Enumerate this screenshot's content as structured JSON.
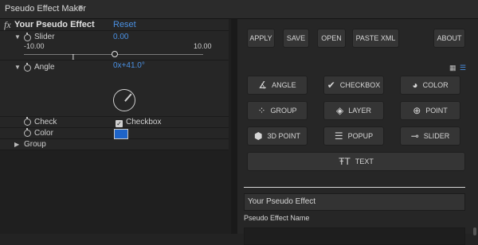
{
  "window": {
    "tab_title": "Pseudo Effect Maker",
    "menu_icon": "hamburger-menu-icon"
  },
  "effect": {
    "fx_label": "fx",
    "name": "Your Pseudo Effect",
    "reset_label": "Reset",
    "params": {
      "slider": {
        "label": "Slider",
        "value": "0.00",
        "min": "-10.00",
        "max": "10.00",
        "position_fraction": 0.5
      },
      "angle": {
        "label": "Angle",
        "value": "0x+41.0°",
        "degrees": 41
      },
      "check": {
        "label": "Check",
        "checkbox_label": "Checkbox",
        "checked": true
      },
      "color": {
        "label": "Color",
        "swatch": "#1E64C8"
      },
      "group": {
        "label": "Group"
      }
    }
  },
  "toolbar": {
    "apply": "APPLY",
    "save": "SAVE",
    "open": "OPEN",
    "paste_xml": "PASTE XML",
    "about": "ABOUT"
  },
  "view_toggle": {
    "grid_icon": "grid-view-icon",
    "list_icon": "list-view-icon"
  },
  "add_buttons": {
    "angle": {
      "label": "ANGLE",
      "icon": "angle-icon"
    },
    "checkbox": {
      "label": "CHECKBOX",
      "icon": "checkbox-icon"
    },
    "color": {
      "label": "COLOR",
      "icon": "palette-icon"
    },
    "group": {
      "label": "GROUP",
      "icon": "group-icon"
    },
    "layer": {
      "label": "LAYER",
      "icon": "layers-icon"
    },
    "point": {
      "label": "POINT",
      "icon": "point-icon"
    },
    "point3d": {
      "label": "3D POINT",
      "icon": "cube-icon"
    },
    "popup": {
      "label": "POPUP",
      "icon": "popup-icon"
    },
    "slider": {
      "label": "SLIDER",
      "icon": "slider-icon"
    },
    "text": {
      "label": "TEXT",
      "icon": "text-icon"
    }
  },
  "effect_name_field": {
    "value": "Your Pseudo Effect",
    "label": "Pseudo Effect Name"
  },
  "colors": {
    "accent": "#4A90E2",
    "panel": "#262626",
    "button": "#353535"
  }
}
